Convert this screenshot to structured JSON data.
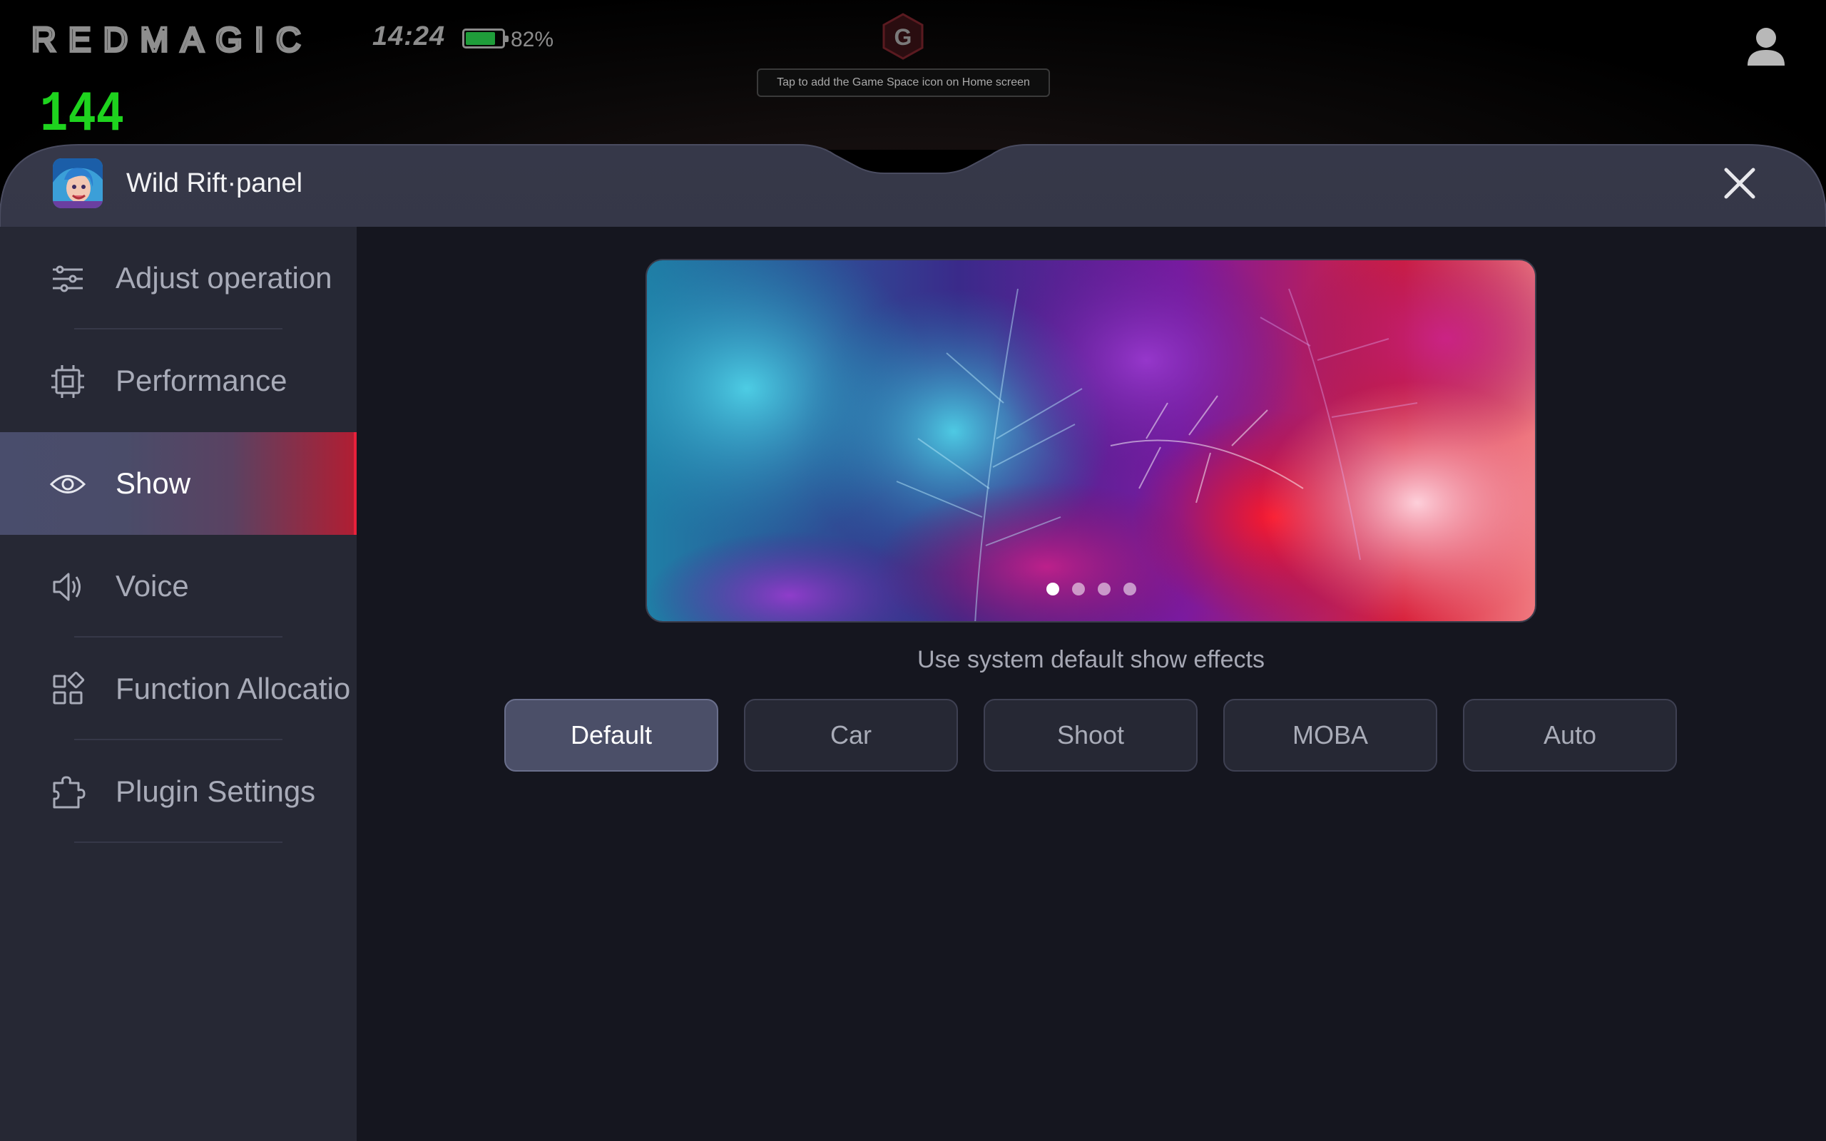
{
  "status": {
    "brand": "REDMAGIC",
    "time": "14:24",
    "battery_percent_label": "82%",
    "battery_level": 0.82,
    "fps": "144",
    "game_space_tip": "Tap to add the Game Space icon on Home screen"
  },
  "panel": {
    "title": "Wild Rift·panel"
  },
  "sidebar": {
    "items": [
      {
        "label": "Adjust operation",
        "icon": "sliders-icon",
        "active": false
      },
      {
        "label": "Performance",
        "icon": "chip-icon",
        "active": false
      },
      {
        "label": "Show",
        "icon": "eye-icon",
        "active": true
      },
      {
        "label": "Voice",
        "icon": "speaker-icon",
        "active": false
      },
      {
        "label": "Function Allocatio",
        "icon": "apps-grid-icon",
        "active": false
      },
      {
        "label": "Plugin Settings",
        "icon": "puzzle-icon",
        "active": false
      }
    ]
  },
  "show": {
    "carousel": {
      "page_count": 4,
      "current_page": 1
    },
    "caption": "Use system default show effects",
    "modes": [
      {
        "label": "Default",
        "active": true
      },
      {
        "label": "Car",
        "active": false
      },
      {
        "label": "Shoot",
        "active": false
      },
      {
        "label": "MOBA",
        "active": false
      },
      {
        "label": "Auto",
        "active": false
      }
    ]
  },
  "colors": {
    "accent_red": "#e8213b",
    "fps_green": "#1ed31e",
    "battery_green": "#1f9d3a",
    "panel_bg": "#15161f",
    "sidebar_bg": "#262834",
    "header_bg": "#2c2e3c"
  }
}
